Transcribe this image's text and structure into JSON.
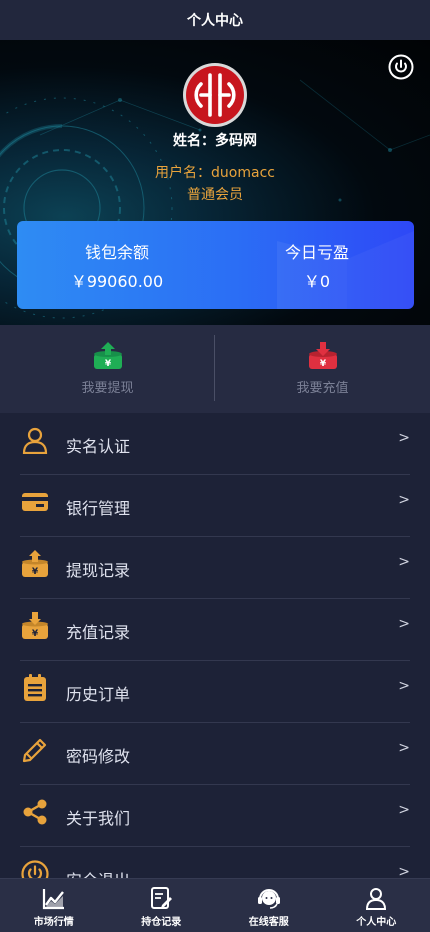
{
  "header": {
    "title": "个人中心"
  },
  "profile": {
    "name_line": "姓名：多码网",
    "username_line": "用户名：duomacc",
    "level_line": "普通会员"
  },
  "wallet": {
    "balance_label": "钱包余额",
    "balance_value": "￥99060.00",
    "pnl_label": "今日亏盈",
    "pnl_value": "￥0"
  },
  "actions": {
    "withdraw_label": "我要提现",
    "recharge_label": "我要充值"
  },
  "menu": {
    "items": [
      {
        "label": "实名认证",
        "arrow": ">",
        "icon": "person-icon"
      },
      {
        "label": "银行管理",
        "arrow": ">",
        "icon": "bank-card-icon"
      },
      {
        "label": "提现记录",
        "arrow": ">",
        "icon": "withdraw-icon"
      },
      {
        "label": "充值记录",
        "arrow": ">",
        "icon": "recharge-icon"
      },
      {
        "label": "历史订单",
        "arrow": ">",
        "icon": "orders-icon"
      },
      {
        "label": "密码修改",
        "arrow": ">",
        "icon": "pencil-icon"
      },
      {
        "label": "关于我们",
        "arrow": ">",
        "icon": "share-icon"
      },
      {
        "label": "安全退出",
        "arrow": ">",
        "icon": "power-icon"
      }
    ]
  },
  "tabbar": {
    "tabs": [
      {
        "label": "市场行情",
        "icon": "chart-icon"
      },
      {
        "label": "持仓记录",
        "icon": "edit-list-icon"
      },
      {
        "label": "在线客服",
        "icon": "headset-icon"
      },
      {
        "label": "个人中心",
        "icon": "user-icon"
      }
    ]
  },
  "colors": {
    "background": "#1d2237",
    "accent_orange": "#e8a33c",
    "wallet_blue_start": "#2e8cf3",
    "wallet_blue_end": "#2e48f6",
    "withdraw_green": "#1fae55",
    "recharge_red": "#e03040"
  }
}
